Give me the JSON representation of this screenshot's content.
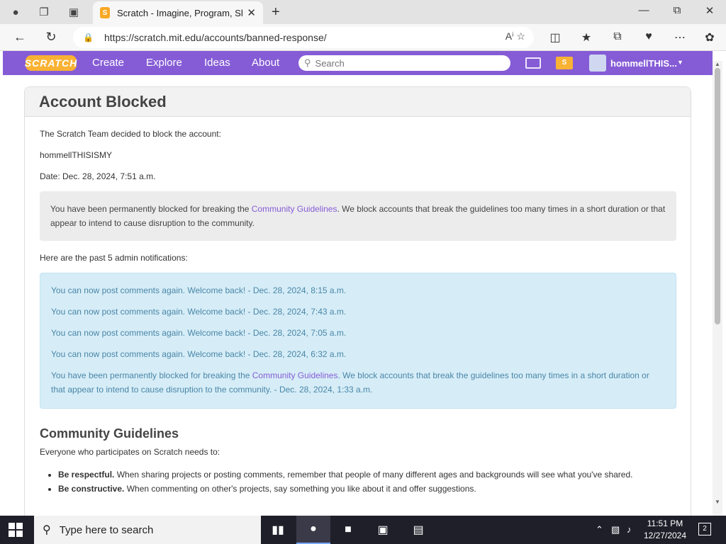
{
  "browser": {
    "tab_title": "Scratch - Imagine, Program, Share",
    "url": "https://scratch.mit.edu/accounts/banned-response/"
  },
  "scratch_nav": {
    "logo": "SCRATCH",
    "links": [
      "Create",
      "Explore",
      "Ideas",
      "About"
    ],
    "search_placeholder": "Search",
    "username": "hommellTHIS..."
  },
  "page": {
    "title": "Account Blocked",
    "intro": "The Scratch Team decided to block the account:",
    "account": "hommellTHISISMY",
    "date": "Date: Dec. 28, 2024, 7:51 a.m.",
    "block_msg_pre": "You have been permanently blocked for breaking the ",
    "block_msg_link": "Community Guidelines",
    "block_msg_post": ". We block accounts that break the guidelines too many times in a short duration or that appear to intend to cause disruption to the community.",
    "notifications_heading": "Here are the past 5 admin notifications:",
    "notifications": [
      "You can now post comments again. Welcome back! - Dec. 28, 2024, 8:15 a.m.",
      "You can now post comments again. Welcome back! - Dec. 28, 2024, 7:43 a.m.",
      "You can now post comments again. Welcome back! - Dec. 28, 2024, 7:05 a.m.",
      "You can now post comments again. Welcome back! - Dec. 28, 2024, 6:32 a.m."
    ],
    "last_notification_pre": "You have been permanently blocked for breaking the ",
    "last_notification_link": "Community Guidelines",
    "last_notification_post": ". We block accounts that break the guidelines too many times in a short duration or that appear to intend to cause disruption to the community. - Dec. 28, 2024, 1:33 a.m.",
    "cg_title": "Community Guidelines",
    "cg_intro": "Everyone who participates on Scratch needs to:",
    "cg_items": [
      {
        "bold": "Be respectful.",
        "text": " When sharing projects or posting comments, remember that people of many different ages and backgrounds will see what you've shared."
      },
      {
        "bold": "Be constructive.",
        "text": " When commenting on other's projects, say something you like about it and offer suggestions."
      }
    ]
  },
  "taskbar": {
    "search_placeholder": "Type here to search",
    "time": "11:51 PM",
    "date": "12/27/2024",
    "notification_count": "2"
  },
  "colors": {
    "scratch_purple": "#855cd6",
    "scratch_orange": "#f9b233",
    "info_blue": "#d6edf7"
  }
}
